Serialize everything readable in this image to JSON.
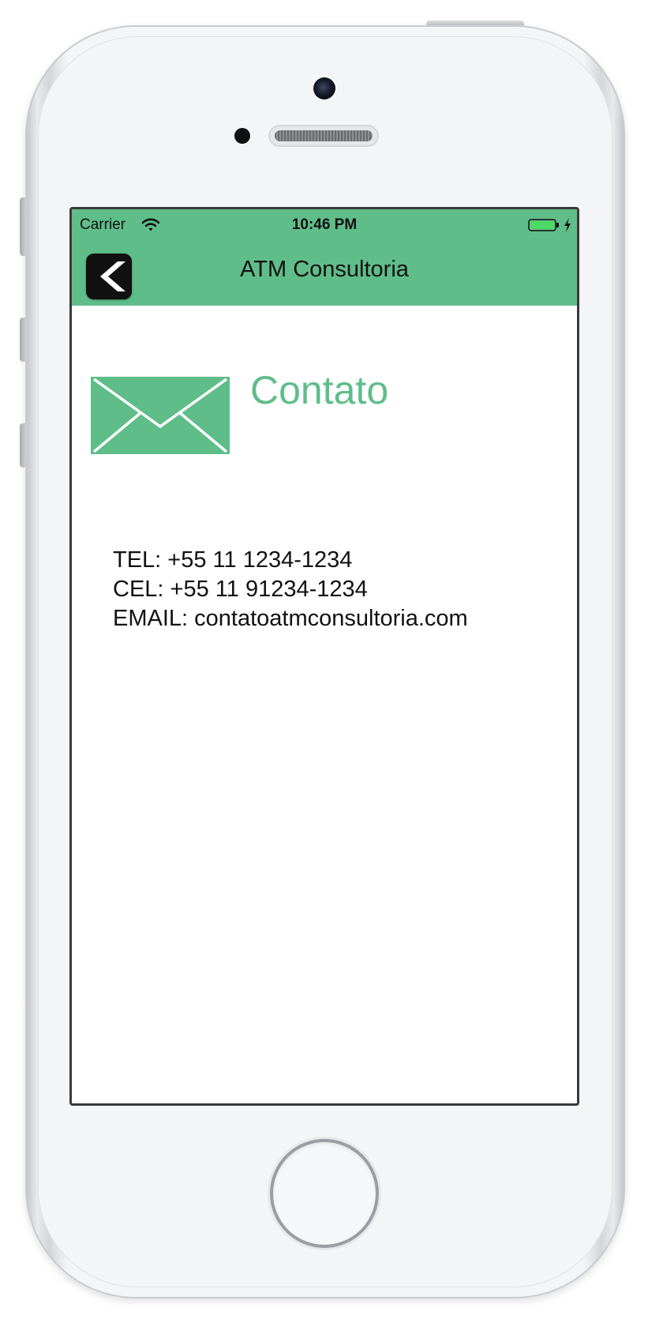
{
  "status_bar": {
    "carrier": "Carrier",
    "time": "10:46 PM",
    "wifi_icon": "wifi-icon",
    "battery_icon": "battery-charging-icon"
  },
  "nav_bar": {
    "title": "ATM Consultoria",
    "back_icon": "chevron-left-icon",
    "background_color": "#5fbd89"
  },
  "content": {
    "icon": "envelope-icon",
    "title": "Contato",
    "accent_color": "#5fbd89",
    "contacts": [
      "TEL: +55 11 1234-1234",
      "CEL: +55 11 91234-1234",
      "EMAIL: contatoatmconsultoria.com"
    ]
  }
}
